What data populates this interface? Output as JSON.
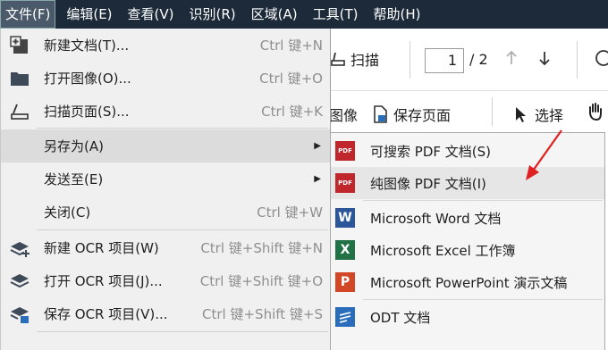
{
  "menubar": {
    "items": [
      "文件(F)",
      "编辑(E)",
      "查看(V)",
      "识别(R)",
      "区域(A)",
      "工具(T)",
      "帮助(H)"
    ]
  },
  "toolbar": {
    "scan_label": "扫描",
    "page_current": "1",
    "page_total": "/ 2",
    "image_partial": "图像",
    "save_page_label": "保存页面",
    "select_label": "选择"
  },
  "file_menu": {
    "items": [
      {
        "icon": "new-document-icon",
        "label": "新建文档(T)...",
        "shortcut": "Ctrl 键+N"
      },
      {
        "icon": "open-folder-icon",
        "label": "打开图像(O)...",
        "shortcut": "Ctrl 键+O"
      },
      {
        "icon": "scanner-icon",
        "label": "扫描页面(S)...",
        "shortcut": "Ctrl 键+K"
      },
      {
        "icon": "",
        "label": "另存为(A)",
        "shortcut": ""
      },
      {
        "icon": "",
        "label": "发送至(E)",
        "shortcut": ""
      },
      {
        "icon": "",
        "label": "关闭(C)",
        "shortcut": "Ctrl 键+W"
      },
      {
        "icon": "new-ocr-project-icon",
        "label": "新建 OCR 项目(W)",
        "shortcut": "Ctrl 键+Shift 键+N"
      },
      {
        "icon": "open-ocr-project-icon",
        "label": "打开 OCR 项目(J)...",
        "shortcut": "Ctrl 键+Shift 键+O"
      },
      {
        "icon": "save-ocr-project-icon",
        "label": "保存 OCR 项目(V)...",
        "shortcut": "Ctrl 键+Shift 键+S"
      }
    ]
  },
  "save_as_menu": {
    "items": [
      {
        "icon": "pdf-icon",
        "label": "可搜索 PDF 文档(S)"
      },
      {
        "icon": "pdf-icon",
        "label": "纯图像 PDF 文档(I)"
      },
      {
        "icon": "word-icon",
        "label": "Microsoft Word 文档"
      },
      {
        "icon": "excel-icon",
        "label": "Microsoft Excel 工作簿"
      },
      {
        "icon": "powerpoint-icon",
        "label": "Microsoft PowerPoint 演示文稿"
      },
      {
        "icon": "odt-icon",
        "label": "ODT 文档"
      }
    ]
  },
  "colors": {
    "menubar_bg": "#1c2a3a",
    "pdf_red": "#c0272d",
    "word_blue": "#2b579a",
    "excel_green": "#217346",
    "powerpoint_orange": "#d24726",
    "odt_blue": "#2a6ebb",
    "annotation_red": "#e0201f"
  }
}
